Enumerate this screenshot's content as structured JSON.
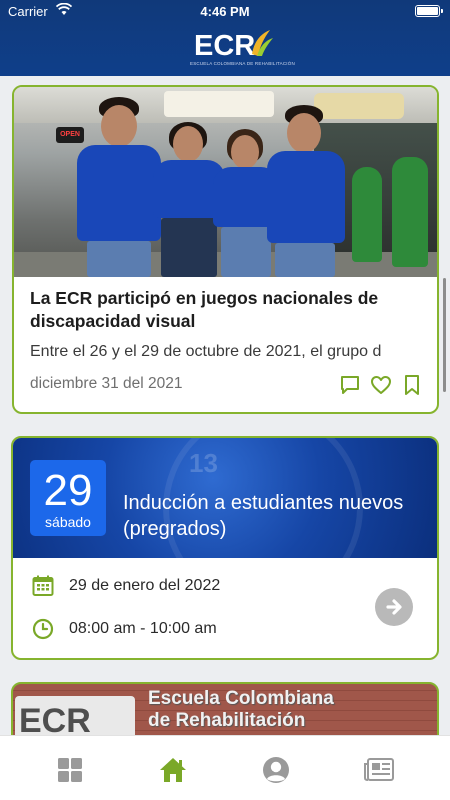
{
  "status_bar": {
    "carrier": "Carrier",
    "time": "4:46 PM"
  },
  "header": {
    "logo_text": "ECR",
    "logo_subtitle": "ESCUELA COLOMBIANA DE REHABILITACIÓN"
  },
  "news_card": {
    "title": "La ECR participó en juegos nacionales de discapacidad visual",
    "excerpt": "Entre el 26 y el 29 de octubre de 2021, el grupo d",
    "date": "diciembre 31 del 2021",
    "photo_signs": {
      "open": "OPEN"
    },
    "actions": [
      "comment-icon",
      "heart-icon",
      "bookmark-icon"
    ]
  },
  "event_card": {
    "day": "29",
    "weekday": "sábado",
    "title": "Inducción a estudiantes nuevos (pregrados)",
    "date": "29 de enero del 2022",
    "time": "08:00 am - 10:00 am"
  },
  "peek_card": {
    "sign_logo": "ECR",
    "sign_line1": "Escuela Colombiana",
    "sign_line2": "de Rehabilitación"
  },
  "bottom_nav": {
    "items": [
      "grid-icon",
      "home-icon",
      "profile-icon",
      "news-icon"
    ],
    "active": "home-icon"
  },
  "colors": {
    "header": "#0f3f8a",
    "accent": "#86b42f",
    "event_blue": "#1c68ea",
    "date_box": "#1c68ea"
  }
}
